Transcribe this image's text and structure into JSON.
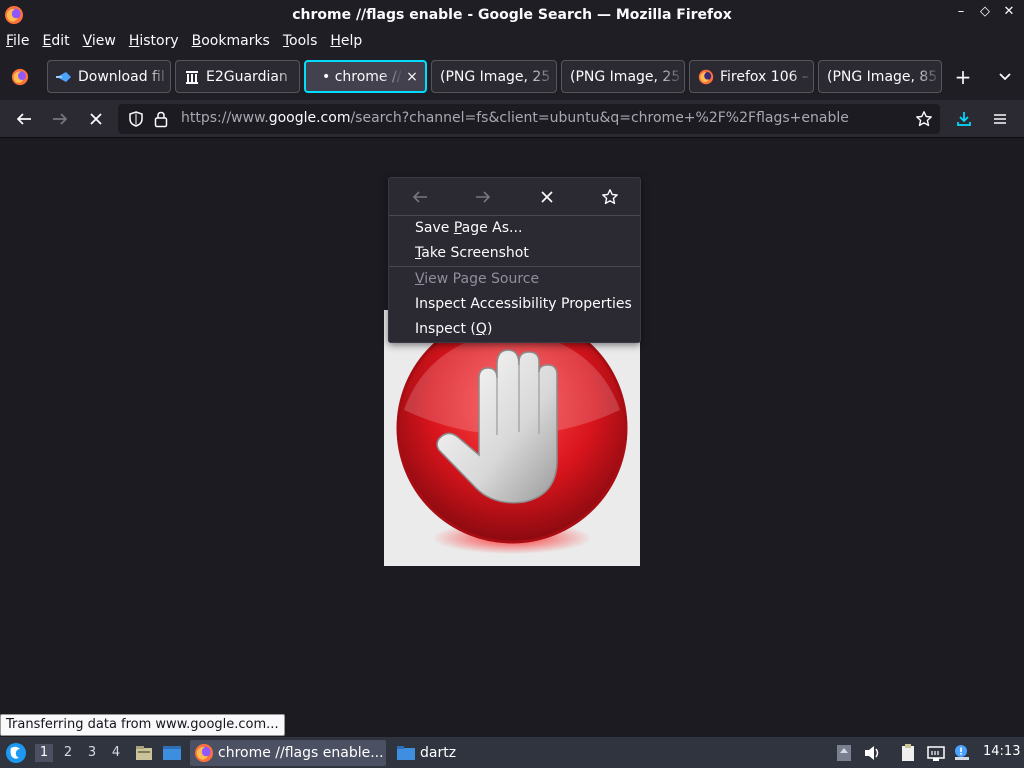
{
  "window": {
    "title": "chrome //flags enable - Google Search — Mozilla Firefox",
    "controls": [
      "–",
      "◇",
      "✕"
    ]
  },
  "menubar": {
    "items": [
      {
        "label": "File",
        "accel": "F",
        "rest": "ile"
      },
      {
        "label": "Edit",
        "accel": "E",
        "rest": "dit"
      },
      {
        "label": "View",
        "accel": "V",
        "rest": "iew"
      },
      {
        "label": "History",
        "accel": "H",
        "rest": "istory"
      },
      {
        "label": "Bookmarks",
        "accel": "B",
        "rest": "ookmarks"
      },
      {
        "label": "Tools",
        "accel": "T",
        "rest": "ools"
      },
      {
        "label": "Help",
        "accel": "H",
        "rest": "elp"
      }
    ]
  },
  "tabs": [
    {
      "label": "Download fil",
      "icon": "download-icon"
    },
    {
      "label": "E2Guardian",
      "icon": "building-icon"
    },
    {
      "label": "• chrome //fl",
      "icon": "loading-icon",
      "active": true,
      "close": "×"
    },
    {
      "label": "(PNG Image, 25",
      "icon": ""
    },
    {
      "label": "(PNG Image, 25",
      "icon": ""
    },
    {
      "label": "Firefox 106 –",
      "icon": "firefox-icon"
    },
    {
      "label": "(PNG Image, 85",
      "icon": ""
    }
  ],
  "toolbar": {
    "new_tab": "+",
    "url_host_prefix": "https://www.",
    "url_host": "google.com",
    "url_path": "/search?channel=fs&client=ubuntu&q=chrome+%2F%2Fflags+enable"
  },
  "context_menu": {
    "items": [
      {
        "label": "Save Page As...",
        "accel_index": 5,
        "disabled": false
      },
      {
        "label": "Take Screenshot",
        "accel_index": 0,
        "disabled": false
      },
      {
        "label": "View Page Source",
        "accel_index": 0,
        "disabled": true
      },
      {
        "label": "Inspect Accessibility Properties",
        "accel_index": -1,
        "disabled": false
      },
      {
        "label": "Inspect (Q)",
        "accel_index": 9,
        "disabled": false
      }
    ]
  },
  "statusbar": {
    "text": "Transferring data from www.google.com..."
  },
  "taskbar": {
    "desktops": [
      "1",
      "2",
      "3",
      "4"
    ],
    "active_desktop": "1",
    "tasks": [
      {
        "label": "chrome //flags enable...",
        "icon": "firefox-icon",
        "active": true
      },
      {
        "label": "dartz",
        "icon": "folder-icon",
        "active": false
      }
    ],
    "clock": "14:13"
  },
  "colors": {
    "accent": "#00ddff",
    "background": "#1c1b22",
    "toolbar": "#2b2a33",
    "stop_sign_red": "#d8141c"
  }
}
